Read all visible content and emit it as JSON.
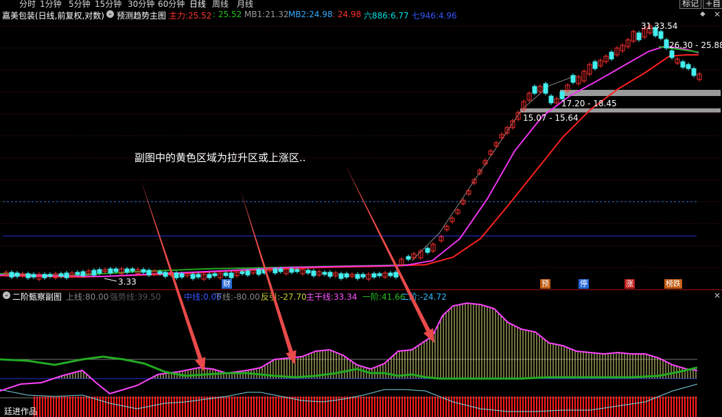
{
  "period_tabs": [
    {
      "label": "分时"
    },
    {
      "label": "1分钟"
    },
    {
      "label": "5分钟"
    },
    {
      "label": "15分钟"
    },
    {
      "label": "30分钟"
    },
    {
      "label": "60分钟"
    },
    {
      "label": "日线",
      "active": true
    },
    {
      "label": "周线"
    },
    {
      "label": "月线"
    }
  ],
  "toolbar_right": {
    "mark_label": "标记",
    "self_select_label": "+自"
  },
  "main_header": {
    "stock_title": "嘉美包装(日线,前复权,对数)",
    "indicator_name": "预测趋势主图",
    "items": [
      {
        "label": "主力:",
        "value": "25.52",
        "color": "#ff3030"
      },
      {
        "label": "",
        "value": ": 25.52",
        "color": "#22c022"
      },
      {
        "label": "MB1:",
        "value": "21.32",
        "color": "#9a9a9a"
      },
      {
        "label": "MB2:",
        "value": "24.98",
        "color": "#33aaff"
      },
      {
        "label": "",
        "value": ": 24.98",
        "color": "#ff3030"
      },
      {
        "label": "六886:",
        "value": "6.77",
        "color": "#00e0e0"
      },
      {
        "label": "七946:",
        "value": "4.96",
        "color": "#3355ff"
      }
    ]
  },
  "price_labels": {
    "high": "31.33.54",
    "range1": "26.30 - 25.88",
    "range2": "17.20 - 18.45",
    "range3": "15.07 - 15.64",
    "low": "3.33"
  },
  "event_markers": [
    {
      "label": "财",
      "color": "#2a6bd8"
    },
    {
      "label": "预",
      "color": "#c05a10"
    },
    {
      "label": "停",
      "color": "#2a6bd8"
    },
    {
      "label": "涨",
      "color": "#c02020"
    },
    {
      "label": "榜跌",
      "color": "#c05a10"
    }
  ],
  "annotation": "副图中的黄色区域为拉升区或上涨区..",
  "sub_header": {
    "indicator_name": "二阶甄察副图",
    "items": [
      {
        "label": "上线:",
        "value": "80.00",
        "color": "#888888"
      },
      {
        "label": "强势线:",
        "value": "39.50",
        "color": "#555555"
      },
      {
        "label": "中线:",
        "value": "0.00",
        "color": "#3355ff"
      },
      {
        "label": "下线:",
        "value": "-80.00",
        "color": "#888888"
      },
      {
        "label": "反引:",
        "value": "-27.70",
        "color": "#cccc33"
      },
      {
        "label": "主干线:",
        "value": "33.34",
        "color": "#ff55ff"
      },
      {
        "label": "一阶:",
        "value": "41.66",
        "color": "#22c022"
      },
      {
        "label": "二阶:",
        "value": "-24.72",
        "color": "#33bbff"
      }
    ]
  },
  "footer_label": "廷进作品",
  "colors": {
    "background": "#000000",
    "up_candle": "#ff3030",
    "down_candle": "#44eeee",
    "ma_red": "#ff2020",
    "ma_magenta": "#ee33ee",
    "ma_green": "#22aa22",
    "sub_yellow": "#e6e680",
    "sub_red": "#ff1a1a",
    "grid_red": "#6a1a1a",
    "guide_blue": "#2233dd",
    "arrow": "#e84a4a"
  }
}
